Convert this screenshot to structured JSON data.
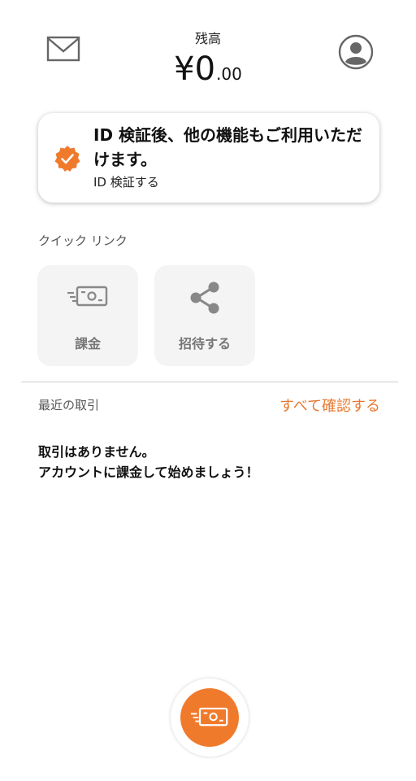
{
  "header": {
    "balance_label": "残高",
    "currency_symbol": "¥",
    "balance_integer": "0",
    "balance_decimal": ".00",
    "mail_icon": "mail-icon",
    "profile_icon": "profile-icon"
  },
  "verify_card": {
    "title": "ID 検証後、他の機能もご利用いただけます。",
    "link": "ID 検証する",
    "icon": "verified-badge-icon"
  },
  "quick_links": {
    "label": "クイック リンク",
    "items": [
      {
        "label": "課金",
        "icon": "cash-icon"
      },
      {
        "label": "招待する",
        "icon": "share-icon"
      }
    ]
  },
  "transactions": {
    "label": "最近の取引",
    "see_all": "すべて確認する",
    "empty_line1": "取引はありません。",
    "empty_line2": "アカウントに課金して始めましょう！"
  },
  "fab": {
    "icon": "cash-icon"
  },
  "colors": {
    "accent": "#f07a2c",
    "link": "#e8782e",
    "tile_bg": "#f4f4f4"
  }
}
